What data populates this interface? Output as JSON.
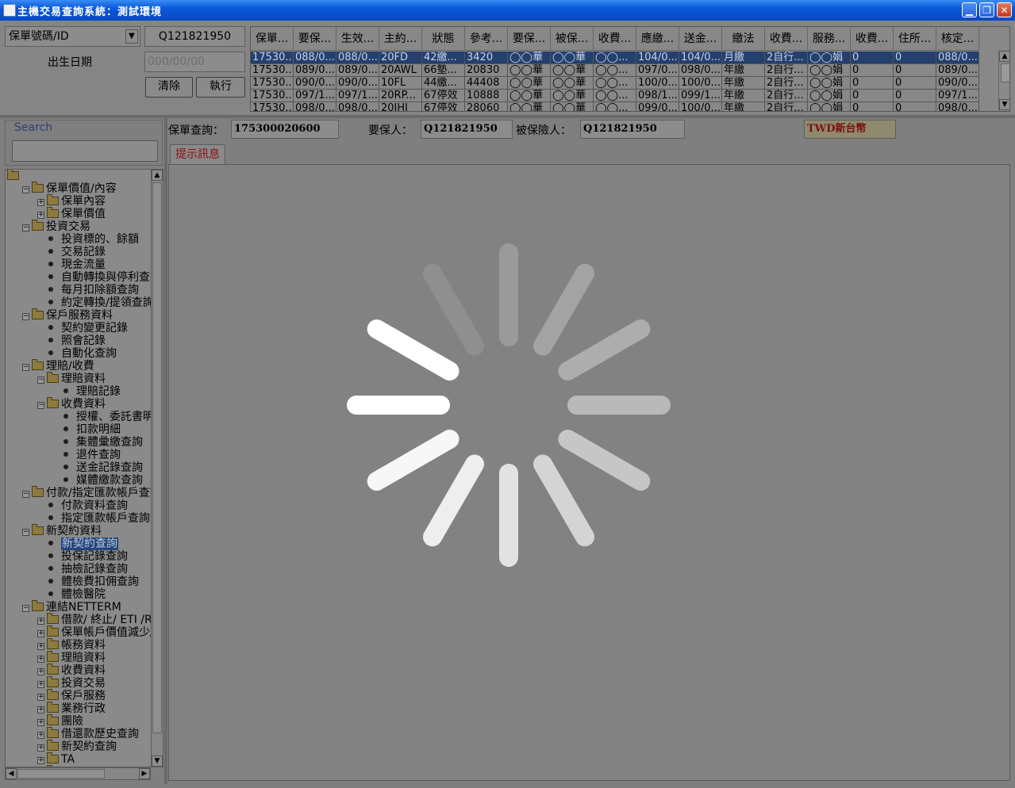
{
  "window": {
    "title": "主機交易查詢系統：測試環境"
  },
  "query": {
    "type_select": "保單號碼/ID",
    "id_value": "Q121821950",
    "birth_label": "出生日期",
    "birth_placeholder": "000/00/00",
    "clear_label": "清除",
    "exec_label": "執行"
  },
  "grid": {
    "headers": [
      "保單...",
      "要保...",
      "生效...",
      "主約...",
      "狀態",
      "參考...",
      "要保...",
      "被保...",
      "收費...",
      "應繳...",
      "送金...",
      "繳法",
      "收費...",
      "服務...",
      "收費...",
      "住所...",
      "核定..."
    ],
    "rows": [
      [
        "17530...",
        "088/0...",
        "088/0...",
        "20FD",
        "42繳...",
        "3420",
        "◯◯華",
        "◯◯華",
        "◯◯...",
        "104/0...",
        "104/0...",
        "月繳",
        "2自行...",
        "◯◯娟",
        "0",
        "0",
        "088/0..."
      ],
      [
        "17530...",
        "089/0...",
        "089/0...",
        "20AWL",
        "66墊...",
        "20830",
        "◯◯華",
        "◯◯華",
        "◯◯...",
        "097/0...",
        "098/0...",
        "年繳",
        "2自行...",
        "◯◯娟",
        "0",
        "0",
        "089/0..."
      ],
      [
        "17530...",
        "090/0...",
        "090/0...",
        "10FL",
        "44繳...",
        "44408",
        "◯◯華",
        "◯◯華",
        "◯◯...",
        "100/0...",
        "100/0...",
        "年繳",
        "2自行...",
        "◯◯娟",
        "0",
        "0",
        "090/0..."
      ],
      [
        "17530...",
        "097/1...",
        "097/1...",
        "20RP...",
        "67停效",
        "10888",
        "◯◯華",
        "◯◯華",
        "◯◯...",
        "098/1...",
        "099/1...",
        "年繳",
        "2自行...",
        "◯◯娟",
        "0",
        "0",
        "097/1..."
      ],
      [
        "17530...",
        "098/0...",
        "098/0...",
        "20JHI",
        "67停效",
        "28060",
        "◯◯華",
        "◯◯華",
        "◯◯...",
        "099/0...",
        "100/0...",
        "年繳",
        "2自行...",
        "◯◯娟",
        "0",
        "0",
        "098/0..."
      ]
    ]
  },
  "search": {
    "label": "Search",
    "value": ""
  },
  "tree": [
    {
      "label": "",
      "level": 0,
      "kind": "folder",
      "exp": ""
    },
    {
      "label": "保單價值/內容",
      "level": 1,
      "kind": "folder",
      "exp": "−"
    },
    {
      "label": "保單內容",
      "level": 2,
      "kind": "folder",
      "exp": "+"
    },
    {
      "label": "保單價值",
      "level": 2,
      "kind": "folder",
      "exp": "+"
    },
    {
      "label": "投資交易",
      "level": 1,
      "kind": "folder",
      "exp": "−"
    },
    {
      "label": "投資標的、餘額",
      "level": 2,
      "kind": "leaf"
    },
    {
      "label": "交易記錄",
      "level": 2,
      "kind": "leaf"
    },
    {
      "label": "現金流量",
      "level": 2,
      "kind": "leaf"
    },
    {
      "label": "自動轉換與停利查詢",
      "level": 2,
      "kind": "leaf"
    },
    {
      "label": "每月扣除額查詢",
      "level": 2,
      "kind": "leaf"
    },
    {
      "label": "約定轉換/提領查詢",
      "level": 2,
      "kind": "leaf"
    },
    {
      "label": "保戶服務資料",
      "level": 1,
      "kind": "folder",
      "exp": "−"
    },
    {
      "label": "契約變更記錄",
      "level": 2,
      "kind": "leaf"
    },
    {
      "label": "照會記錄",
      "level": 2,
      "kind": "leaf"
    },
    {
      "label": "自動化查詢",
      "level": 2,
      "kind": "leaf"
    },
    {
      "label": "理賠/收費",
      "level": 1,
      "kind": "folder",
      "exp": "−"
    },
    {
      "label": "理賠資料",
      "level": 2,
      "kind": "folder",
      "exp": "−"
    },
    {
      "label": "理賠記錄",
      "level": 3,
      "kind": "leaf"
    },
    {
      "label": "收費資料",
      "level": 2,
      "kind": "folder",
      "exp": "−"
    },
    {
      "label": "授權、委託書明細",
      "level": 3,
      "kind": "leaf"
    },
    {
      "label": "扣款明細",
      "level": 3,
      "kind": "leaf"
    },
    {
      "label": "集體彙繳查詢",
      "level": 3,
      "kind": "leaf"
    },
    {
      "label": "退件查詢",
      "level": 3,
      "kind": "leaf"
    },
    {
      "label": "送金記錄查詢",
      "level": 3,
      "kind": "leaf"
    },
    {
      "label": "媒體繳款查詢",
      "level": 3,
      "kind": "leaf"
    },
    {
      "label": "付款/指定匯款帳戶查詢",
      "level": 1,
      "kind": "folder",
      "exp": "−"
    },
    {
      "label": "付款資料查詢",
      "level": 2,
      "kind": "leaf"
    },
    {
      "label": "指定匯款帳戶查詢",
      "level": 2,
      "kind": "leaf"
    },
    {
      "label": "新契約資料",
      "level": 1,
      "kind": "folder",
      "exp": "−"
    },
    {
      "label": "新契約查詢",
      "level": 2,
      "kind": "leaf",
      "selected": true
    },
    {
      "label": "投保記錄查詢",
      "level": 2,
      "kind": "leaf"
    },
    {
      "label": "抽檢記錄查詢",
      "level": 2,
      "kind": "leaf"
    },
    {
      "label": "體檢費扣佣查詢",
      "level": 2,
      "kind": "leaf"
    },
    {
      "label": "體檢醫院",
      "level": 2,
      "kind": "leaf"
    },
    {
      "label": "連結NETTERM",
      "level": 1,
      "kind": "folder",
      "exp": "−"
    },
    {
      "label": "借款/ 終止/ ETI /RPU",
      "level": 2,
      "kind": "folder",
      "exp": "+"
    },
    {
      "label": "保單帳戶價值減少/...",
      "level": 2,
      "kind": "folder",
      "exp": "+"
    },
    {
      "label": "帳務資料",
      "level": 2,
      "kind": "folder",
      "exp": "+"
    },
    {
      "label": "理賠資料",
      "level": 2,
      "kind": "folder",
      "exp": "+"
    },
    {
      "label": "收費資料",
      "level": 2,
      "kind": "folder",
      "exp": "+"
    },
    {
      "label": "投資交易",
      "level": 2,
      "kind": "folder",
      "exp": "+"
    },
    {
      "label": "保戶服務",
      "level": 2,
      "kind": "folder",
      "exp": "+"
    },
    {
      "label": "業務行政",
      "level": 2,
      "kind": "folder",
      "exp": "+"
    },
    {
      "label": "團險",
      "level": 2,
      "kind": "folder",
      "exp": "+"
    },
    {
      "label": "借還款歷史查詢",
      "level": 2,
      "kind": "folder",
      "exp": "+"
    },
    {
      "label": "新契約查詢",
      "level": 2,
      "kind": "folder",
      "exp": "+"
    },
    {
      "label": "TA",
      "level": 2,
      "kind": "folder",
      "exp": "+"
    },
    {
      "label": "...",
      "level": 2,
      "kind": "folder",
      "exp": "+"
    }
  ],
  "policy_bar": {
    "policy_label": "保單查詢：",
    "policy_value": "175300020600",
    "applicant_label": "要保人：",
    "applicant_value": "Q121821950",
    "insured_label": "被保險人：",
    "insured_value": "Q121821950",
    "currency": "TWD新台幣"
  },
  "tab": {
    "label": "提示訊息"
  },
  "loading": {
    "spinner": "loading-spinner-icon"
  }
}
